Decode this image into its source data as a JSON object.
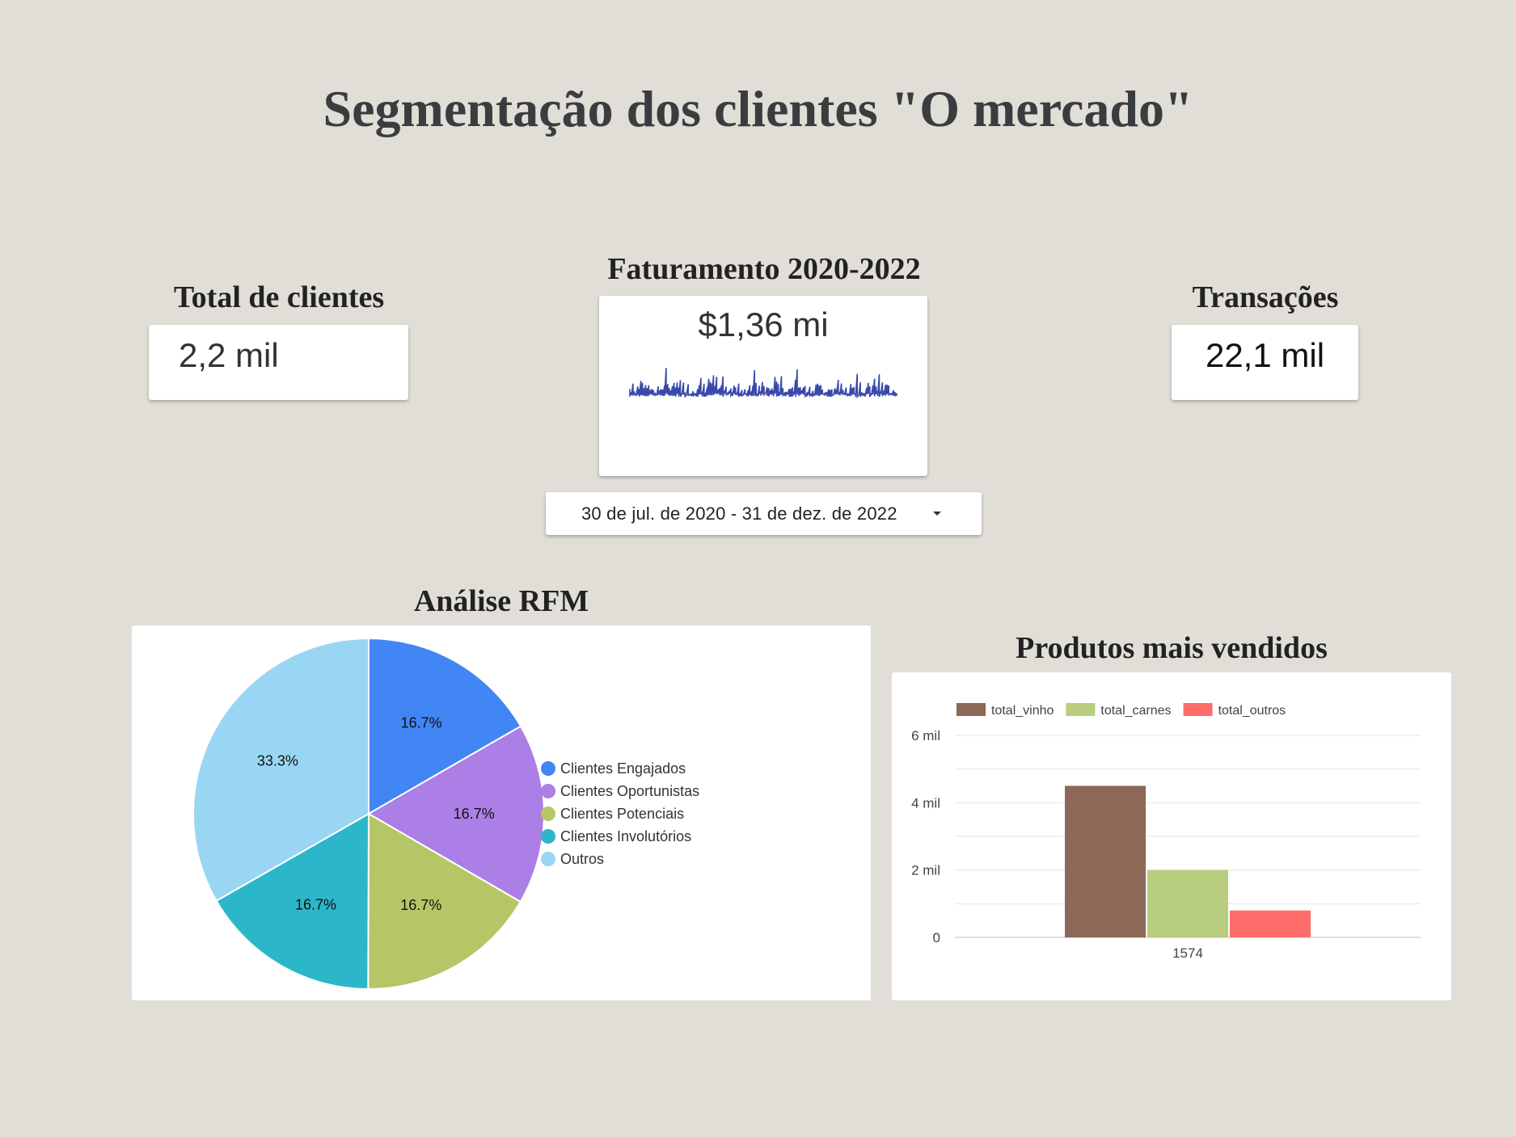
{
  "page": {
    "title": "Segmentação dos clientes \"O mercado\""
  },
  "kpis": {
    "clientes": {
      "title": "Total de clientes",
      "value": "2,2 mil"
    },
    "faturamento": {
      "title": "Faturamento 2020-2022",
      "value": "$1,36 mi",
      "sparkline_color": "#3949ab"
    },
    "transacoes": {
      "title": "Transações",
      "value": "22,1 mil"
    }
  },
  "date_range": {
    "label": "30 de jul. de 2020 - 31 de dez. de 2022"
  },
  "chart_data": [
    {
      "type": "pie",
      "title": "Análise RFM",
      "labels": [
        "Clientes Engajados",
        "Clientes Oportunistas",
        "Clientes Potenciais",
        "Clientes Involutórios",
        "Outros"
      ],
      "values": [
        16.7,
        16.7,
        16.7,
        16.7,
        33.3
      ],
      "value_labels": [
        "16.7%",
        "16.7%",
        "16.7%",
        "16.7%",
        "33.3%"
      ],
      "colors": [
        "#4285f4",
        "#ab7fe6",
        "#b5c667",
        "#2bb7c9",
        "#99d6f4"
      ],
      "legend": "right"
    },
    {
      "type": "bar",
      "title": "Produtos mais vendidos",
      "categories": [
        "1574"
      ],
      "series": [
        {
          "name": "total_vinho",
          "values": [
            4500
          ],
          "color": "#8b6857"
        },
        {
          "name": "total_carnes",
          "values": [
            2000
          ],
          "color": "#b9cd7f"
        },
        {
          "name": "total_outros",
          "values": [
            800
          ],
          "color": "#ff6d6b"
        }
      ],
      "ylim": [
        0,
        6000
      ],
      "yticks": [
        0,
        2000,
        4000,
        6000
      ],
      "ytick_labels": [
        "0",
        "2 mil",
        "4 mil",
        "6 mil"
      ],
      "grid": true,
      "legend": "top-left"
    }
  ]
}
